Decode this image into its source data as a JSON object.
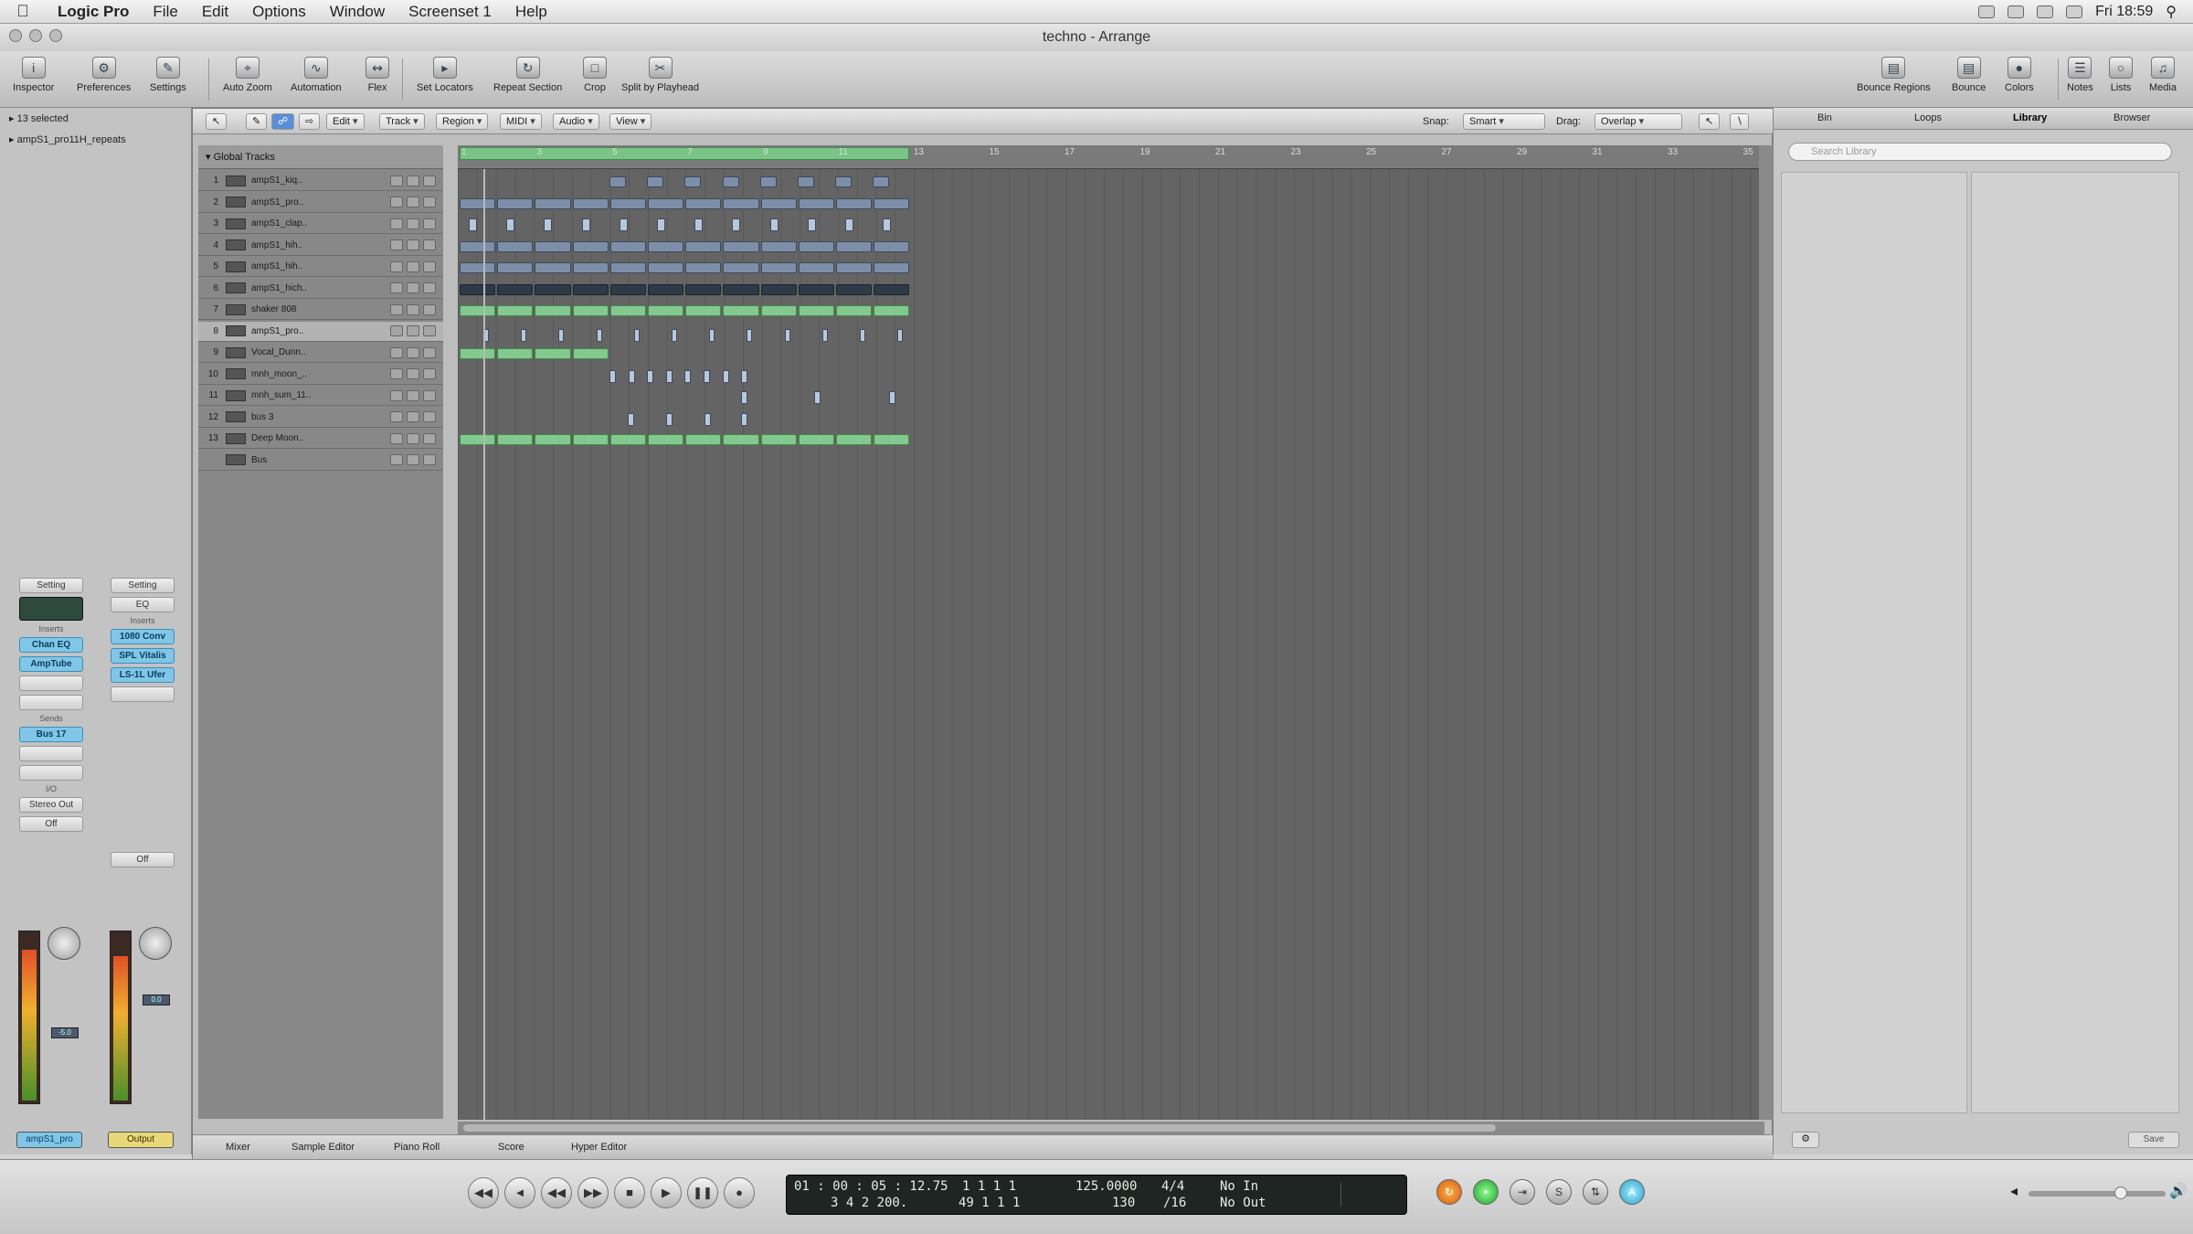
{
  "menubar": {
    "app": "Logic Pro",
    "items": [
      "File",
      "Edit",
      "Options",
      "Window",
      "Screenset 1",
      "Help"
    ],
    "clock": "Fri 18:59"
  },
  "window": {
    "title": "techno - Arrange"
  },
  "toolbar": {
    "left": [
      "Inspector",
      "Preferences",
      "Settings"
    ],
    "middle": [
      "Auto Zoom",
      "Automation",
      "Flex",
      "Set Locators",
      "Repeat Section",
      "Crop",
      "Split by Playhead"
    ],
    "right": [
      "Bounce Regions",
      "Bounce",
      "Colors",
      "Notes",
      "Lists",
      "Media"
    ]
  },
  "inspector": {
    "selection": "13 selected",
    "region": "ampS1_pro11H_repeats",
    "strip1": {
      "setting": "Setting",
      "inserts": [
        "Chan EQ",
        "AmpTube"
      ],
      "send": "Bus 17",
      "output": "Stereo Out",
      "mode": "Off",
      "name": "ampS1_pro"
    },
    "strip2": {
      "setting": "Setting",
      "eq": "EQ",
      "inserts": [
        "1080 Conv",
        "SPL Vitalis",
        "LS-1L Ufer"
      ],
      "mode": "Off",
      "name": "Output"
    },
    "labels": {
      "inserts": "Inserts",
      "sends": "Sends",
      "io": "I/O"
    }
  },
  "arrange": {
    "toolbar": {
      "menus": [
        "Edit",
        "Track",
        "Region",
        "MIDI",
        "Audio",
        "View"
      ],
      "snap_label": "Snap:",
      "snap_value": "Smart",
      "drag_label": "Drag:",
      "drag_value": "Overlap"
    },
    "global_tracks": "Global Tracks",
    "ruler": [
      "1",
      "3",
      "5",
      "7",
      "9",
      "11",
      "13",
      "15",
      "17",
      "19",
      "21",
      "23",
      "25",
      "27",
      "29",
      "31",
      "33",
      "35"
    ],
    "tracks": [
      {
        "num": "1",
        "name": "ampS1_kiq.."
      },
      {
        "num": "2",
        "name": "ampS1_pro.."
      },
      {
        "num": "3",
        "name": "ampS1_clap.."
      },
      {
        "num": "4",
        "name": "ampS1_hih.."
      },
      {
        "num": "5",
        "name": "ampS1_hih.."
      },
      {
        "num": "6",
        "name": "ampS1_hich.."
      },
      {
        "num": "7",
        "name": "shaker 808"
      },
      {
        "num": "8",
        "name": "ampS1_pro.."
      },
      {
        "num": "9",
        "name": "Vocal_Dunn.."
      },
      {
        "num": "10",
        "name": "mnh_moon_.."
      },
      {
        "num": "11",
        "name": "mnh_sum_11.."
      },
      {
        "num": "12",
        "name": "bus 3"
      },
      {
        "num": "13",
        "name": "Deep Moon.."
      },
      {
        "num": "",
        "name": "Bus"
      }
    ],
    "bottom_tabs": [
      "Mixer",
      "Sample Editor",
      "Piano Roll",
      "Score",
      "Hyper Editor"
    ]
  },
  "library": {
    "tabs": [
      "Bin",
      "Loops",
      "Library",
      "Browser"
    ],
    "active_tab": "Library",
    "search_placeholder": "Search Library",
    "footer_button": "Save"
  },
  "transport": {
    "time": "01 : 00 : 05 : 12.75",
    "time_sub": "3   4   2  200.",
    "bars": "1    1    1      1",
    "bars_sub": "49   1    1      1",
    "tempo": "125.0000",
    "tempo_sub": "130",
    "signature": "4/4",
    "division": "/16",
    "in": "No In",
    "out": "No Out"
  },
  "colors": {
    "midi_region": "#83c98f",
    "audio_region": "#7d8fa8",
    "cycle": "#79c486",
    "channel_button": "#7fc6e8"
  }
}
